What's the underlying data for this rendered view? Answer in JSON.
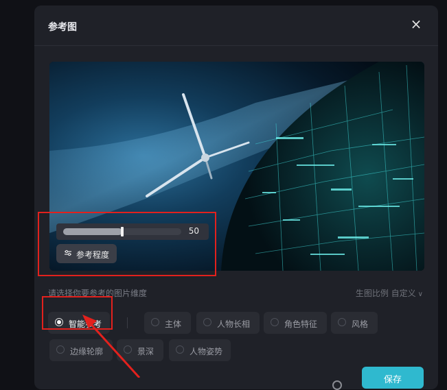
{
  "dialog": {
    "title": "参考图",
    "close_icon": "×"
  },
  "reference_control": {
    "slider_value": 50,
    "slider_fraction": 0.5,
    "button_label": "参考程度",
    "button_icon": "sliders-icon"
  },
  "dimension_hint": "请选择你要参考的图片维度",
  "aspect_ratio": {
    "label": "生图比例 自定义",
    "icon": "chevron-down-icon"
  },
  "options": [
    {
      "label": "智能参考",
      "selected": true
    },
    {
      "label": "主体",
      "selected": false
    },
    {
      "label": "人物长相",
      "selected": false
    },
    {
      "label": "角色特征",
      "selected": false
    },
    {
      "label": "风格",
      "selected": false
    },
    {
      "label": "边缘轮廓",
      "selected": false
    },
    {
      "label": "景深",
      "selected": false
    },
    {
      "label": "人物姿势",
      "selected": false
    }
  ],
  "footer": {
    "save_label": "保存"
  },
  "colors": {
    "accent": "#2fb9cf",
    "annotation": "#e3211d",
    "dialog_bg": "#1f2128"
  }
}
